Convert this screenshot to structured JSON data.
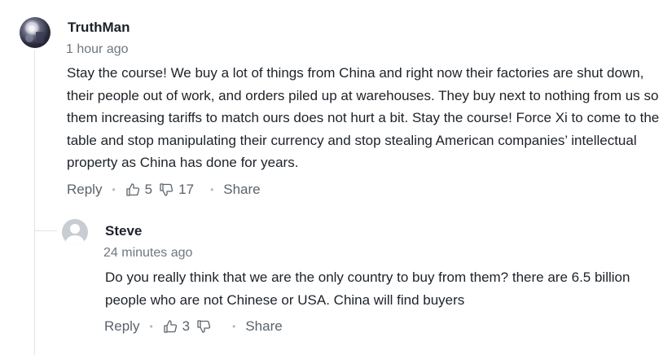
{
  "comments": [
    {
      "author": "TruthMan",
      "time": "1 hour ago",
      "text": "Stay the course! We buy a lot of things from China and right now their factories are shut down, their people out of work, and orders piled up at warehouses. They buy next to nothing from us so them increasing tariffs to match ours does not hurt a bit. Stay the course! Force Xi to come to the table and stop manipulating their currency and stop stealing American companies’ intellectual property as China has done for years.",
      "reply_label": "Reply",
      "upvotes": "5",
      "downvotes": "17",
      "share_label": "Share",
      "avatar_icon": "user-photo"
    },
    {
      "author": "Steve",
      "time": "24 minutes ago",
      "text": "Do you really think that we are the only country to buy from them? there are 6.5 billion people who are not Chinese or USA. China will find buyers",
      "reply_label": "Reply",
      "upvotes": "3",
      "downvotes": "",
      "share_label": "Share",
      "avatar_icon": "default-user"
    }
  ],
  "colors": {
    "text": "#1d2228",
    "muted": "#6e7780",
    "action": "#5b636a",
    "thread_line": "#e0e4e9"
  }
}
